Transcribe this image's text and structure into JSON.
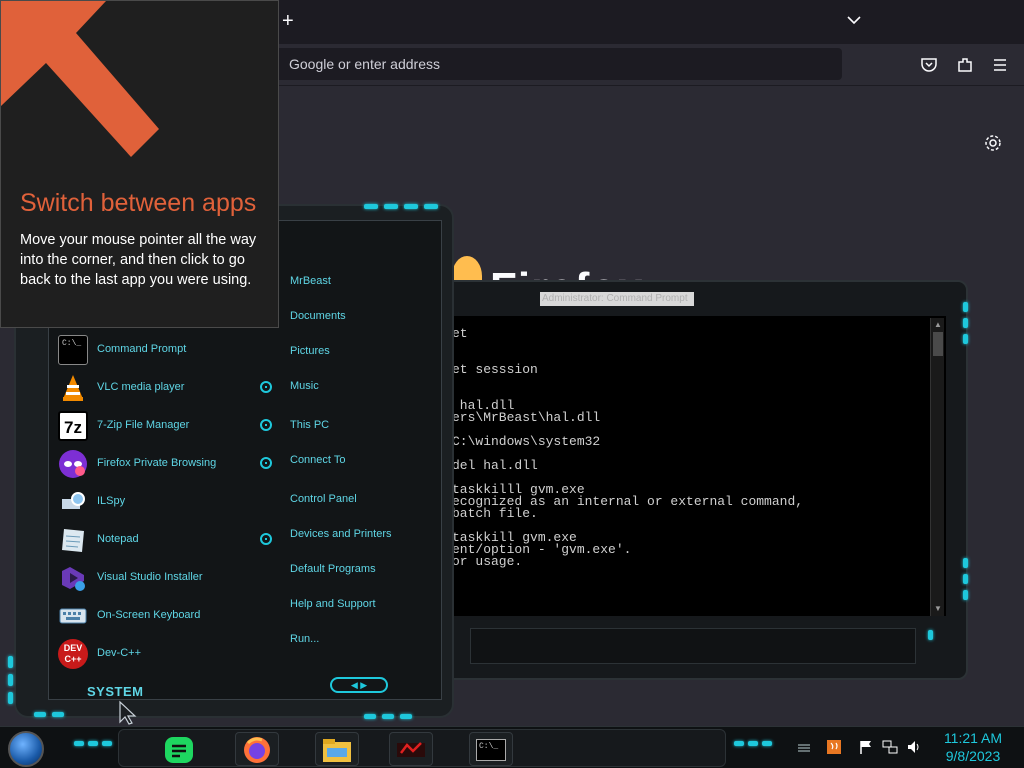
{
  "firefox": {
    "new_tab_symbol": "+",
    "url_placeholder": "Google or enter address",
    "brand_partial": "Firefox"
  },
  "hot_corner_tip": {
    "title": "Switch between apps",
    "body": "Move your mouse pointer all the way into the corner, and then click to go back to the last app you were using.",
    "accent_color": "#e0613a"
  },
  "cmd": {
    "title": "Administrator: Command Prompt",
    "lines": [
      "et",
      "",
      "",
      "et sesssion",
      "",
      "",
      " hal.dll",
      "ers\\MrBeast\\hal.dll",
      "",
      "C:\\windows\\system32",
      "",
      "del hal.dll",
      "",
      "taskkilll gvm.exe",
      "ecognized as an internal or external command,",
      "batch file.",
      "",
      "taskkill gvm.exe",
      "ent/option - 'gvm.exe'.",
      "or usage."
    ]
  },
  "start_menu": {
    "programs": [
      {
        "label": "Command Prompt",
        "icon": "command-prompt-icon",
        "pinned": false
      },
      {
        "label": "VLC media player",
        "icon": "vlc-icon",
        "pinned": true
      },
      {
        "label": "7-Zip File Manager",
        "icon": "7zip-icon",
        "pinned": true
      },
      {
        "label": "Firefox Private Browsing",
        "icon": "firefox-private-icon",
        "pinned": true
      },
      {
        "label": "ILSpy",
        "icon": "ilspy-icon",
        "pinned": false
      },
      {
        "label": "Notepad",
        "icon": "notepad-icon",
        "pinned": true
      },
      {
        "label": "Visual Studio Installer",
        "icon": "vs-installer-icon",
        "pinned": false
      },
      {
        "label": "On-Screen Keyboard",
        "icon": "keyboard-icon",
        "pinned": false
      },
      {
        "label": "Dev-C++",
        "icon": "devcpp-icon",
        "pinned": false
      }
    ],
    "places": [
      "MrBeast",
      "Documents",
      "Pictures",
      "Music",
      "This PC",
      "Connect To",
      "Control Panel",
      "Devices and Printers",
      "Default Programs",
      "Help and Support",
      "Run..."
    ],
    "system_label": "SYSTEM",
    "nav_glyphs": "◀ ▶"
  },
  "taskbar": {
    "time": "11:21 AM",
    "date": "9/8/2023",
    "accent": "#1ec8dc"
  }
}
